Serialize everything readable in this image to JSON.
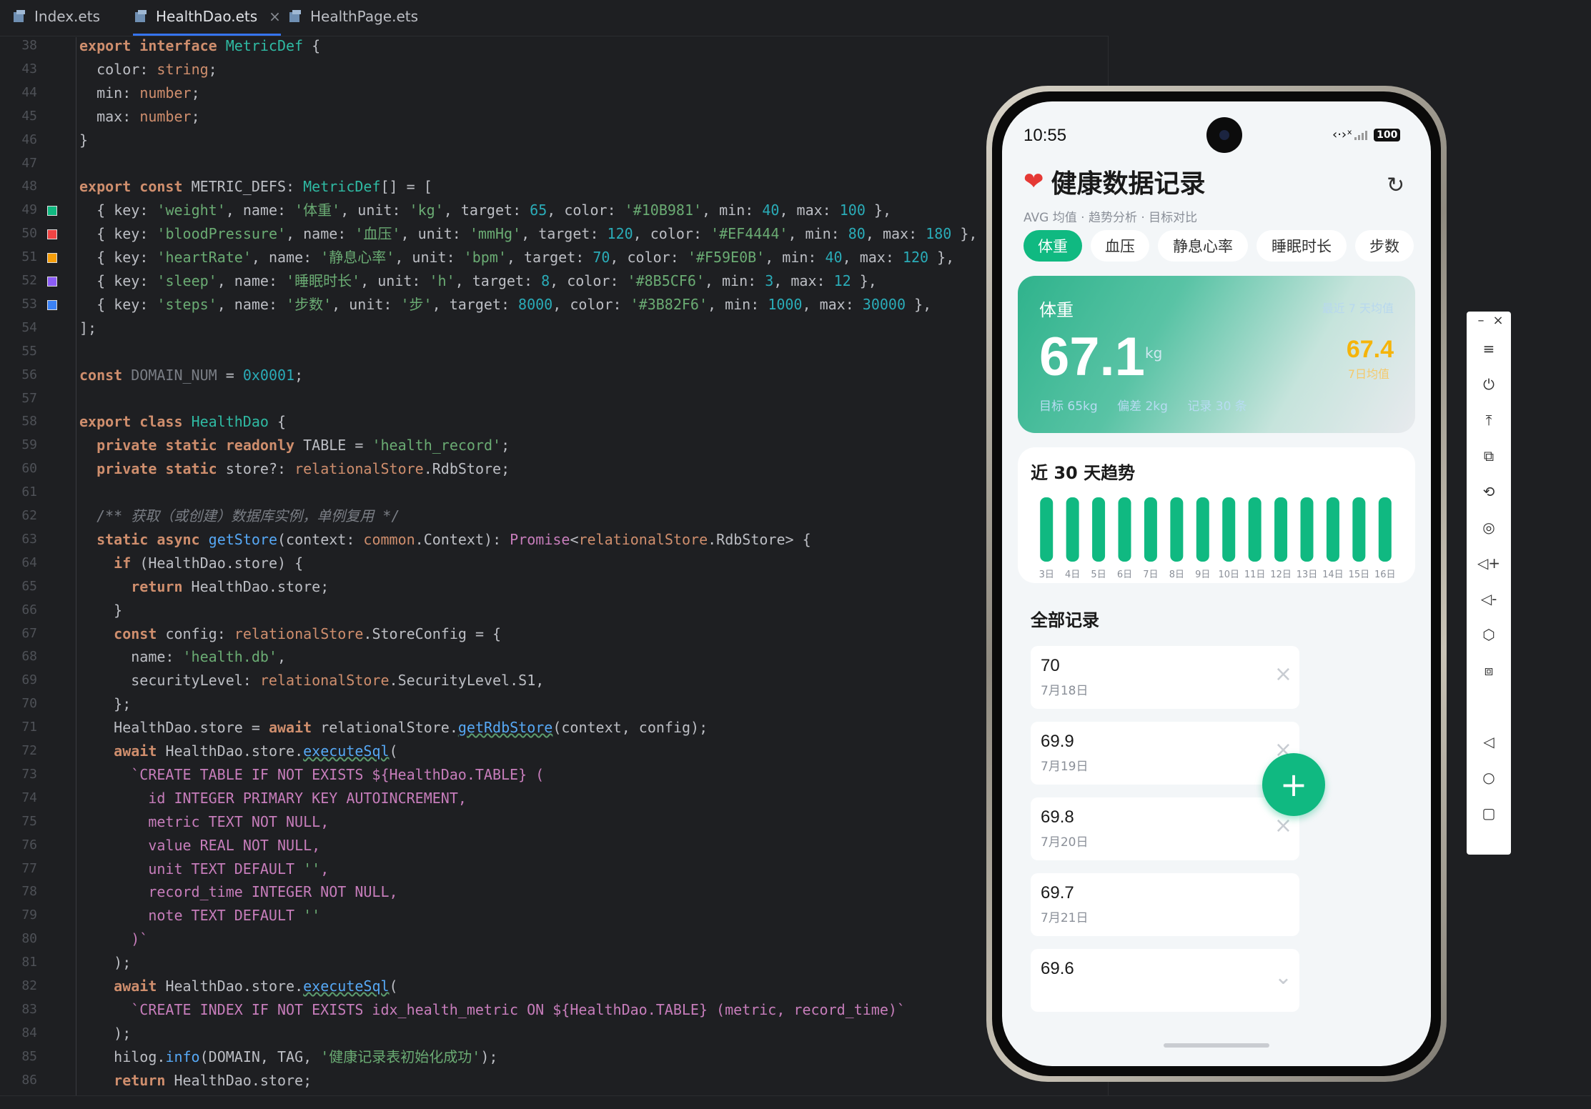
{
  "tabs": [
    {
      "label": "Index.ets",
      "active": false
    },
    {
      "label": "HealthDao.ets",
      "active": true
    },
    {
      "label": "HealthPage.ets",
      "active": false
    }
  ],
  "close_glyph": "×",
  "code_lines": [
    {
      "n": "38",
      "t": "export interface MetricDef {"
    },
    {
      "n": "43",
      "t": "  color: string;"
    },
    {
      "n": "44",
      "t": "  min: number;"
    },
    {
      "n": "45",
      "t": "  max: number;"
    },
    {
      "n": "46",
      "t": "}"
    },
    {
      "n": "47",
      "t": ""
    },
    {
      "n": "48",
      "t": "export const METRIC_DEFS: MetricDef[] = ["
    },
    {
      "n": "49",
      "t": "  { key: 'weight', name: '体重', unit: 'kg', target: 65, color: '#10B981', min: 40, max: 100 },",
      "swatch": "#10B981"
    },
    {
      "n": "50",
      "t": "  { key: 'bloodPressure', name: '血压', unit: 'mmHg', target: 120, color: '#EF4444', min: 80, max: 180 },",
      "swatch": "#EF4444"
    },
    {
      "n": "51",
      "t": "  { key: 'heartRate', name: '静息心率', unit: 'bpm', target: 70, color: '#F59E0B', min: 40, max: 120 },",
      "swatch": "#F59E0B"
    },
    {
      "n": "52",
      "t": "  { key: 'sleep', name: '睡眠时长', unit: 'h', target: 8, color: '#8B5CF6', min: 3, max: 12 },",
      "swatch": "#8B5CF6"
    },
    {
      "n": "53",
      "t": "  { key: 'steps', name: '步数', unit: '步', target: 8000, color: '#3B82F6', min: 1000, max: 30000 },",
      "swatch": "#3B82F6"
    },
    {
      "n": "54",
      "t": "];"
    },
    {
      "n": "55",
      "t": ""
    },
    {
      "n": "56",
      "t": "const DOMAIN_NUM = 0x0001;"
    },
    {
      "n": "57",
      "t": ""
    },
    {
      "n": "58",
      "t": "export class HealthDao {"
    },
    {
      "n": "59",
      "t": "  private static readonly TABLE = 'health_record';"
    },
    {
      "n": "60",
      "t": "  private static store?: relationalStore.RdbStore;"
    },
    {
      "n": "61",
      "t": ""
    },
    {
      "n": "62",
      "t": "  /** 获取（或创建）数据库实例，单例复用 */"
    },
    {
      "n": "63",
      "t": "  static async getStore(context: common.Context): Promise<relationalStore.RdbStore> {"
    },
    {
      "n": "64",
      "t": "    if (HealthDao.store) {"
    },
    {
      "n": "65",
      "t": "      return HealthDao.store;"
    },
    {
      "n": "66",
      "t": "    }"
    },
    {
      "n": "67",
      "t": "    const config: relationalStore.StoreConfig = {"
    },
    {
      "n": "68",
      "t": "      name: 'health.db',"
    },
    {
      "n": "69",
      "t": "      securityLevel: relationalStore.SecurityLevel.S1,"
    },
    {
      "n": "70",
      "t": "    };"
    },
    {
      "n": "71",
      "t": "    HealthDao.store = await relationalStore.getRdbStore(context, config);"
    },
    {
      "n": "72",
      "t": "    await HealthDao.store.executeSql("
    },
    {
      "n": "73",
      "t": "      `CREATE TABLE IF NOT EXISTS ${HealthDao.TABLE} ("
    },
    {
      "n": "74",
      "t": "        id INTEGER PRIMARY KEY AUTOINCREMENT,"
    },
    {
      "n": "75",
      "t": "        metric TEXT NOT NULL,"
    },
    {
      "n": "76",
      "t": "        value REAL NOT NULL,"
    },
    {
      "n": "77",
      "t": "        unit TEXT DEFAULT '',"
    },
    {
      "n": "78",
      "t": "        record_time INTEGER NOT NULL,"
    },
    {
      "n": "79",
      "t": "        note TEXT DEFAULT ''"
    },
    {
      "n": "80",
      "t": "      )`"
    },
    {
      "n": "81",
      "t": "    );"
    },
    {
      "n": "82",
      "t": "    await HealthDao.store.executeSql("
    },
    {
      "n": "83",
      "t": "      `CREATE INDEX IF NOT EXISTS idx_health_metric ON ${HealthDao.TABLE} (metric, record_time)`"
    },
    {
      "n": "84",
      "t": "    );"
    },
    {
      "n": "85",
      "t": "    hilog.info(DOMAIN, TAG, '健康记录表初始化成功');"
    },
    {
      "n": "86",
      "t": "    return HealthDao.store;"
    }
  ],
  "phone": {
    "time": "10:55",
    "status_icons": "‹·›ˣ",
    "battery": "100",
    "app_title": "健康数据记录",
    "subtitle": "AVG 均值 · 趋势分析 · 目标对比",
    "metric_tabs": [
      {
        "label": "体重",
        "active": true
      },
      {
        "label": "血压",
        "active": false
      },
      {
        "label": "静息心率",
        "active": false
      },
      {
        "label": "睡眠时长",
        "active": false
      },
      {
        "label": "步数",
        "active": false
      }
    ],
    "main_card": {
      "label": "体重",
      "hint": "最近 7 天均值",
      "value": "67.1",
      "unit": "kg",
      "avg_value": "67.4",
      "avg_label": "7日均值",
      "target": "目标 65kg",
      "diff": "偏差 2kg",
      "count": "记录 30 条"
    },
    "trend_title": "近 30 天趋势",
    "records_title": "全部记录",
    "records": [
      {
        "value": "70",
        "date": "7月18日"
      },
      {
        "value": "69.9",
        "date": "7月19日"
      },
      {
        "value": "69.8",
        "date": "7月20日"
      },
      {
        "value": "69.7",
        "date": "7月21日"
      },
      {
        "value": "69.6",
        "date": ""
      }
    ],
    "fab_label": "+"
  },
  "chart_data": {
    "type": "bar",
    "categories": [
      "3日",
      "4日",
      "5日",
      "6日",
      "7日",
      "8日",
      "9日",
      "10日",
      "11日",
      "12日",
      "13日",
      "14日",
      "15日",
      "16日"
    ],
    "values": [
      70,
      70,
      70,
      70,
      70,
      70,
      70,
      70,
      70,
      70,
      70,
      70,
      70,
      70
    ],
    "color": "#10B981",
    "grid": false,
    "ylim": [
      0,
      70
    ]
  },
  "toolbar": {
    "items": [
      "–",
      "×",
      "≡",
      "⏻",
      "⤒",
      "⧉",
      "⟲",
      "◎",
      "◁+",
      "◁-",
      "⬡",
      "⧈",
      "◁",
      "○",
      "▢"
    ]
  },
  "colors": {
    "accent": "#10B981",
    "tab_active": "#3574f0"
  }
}
